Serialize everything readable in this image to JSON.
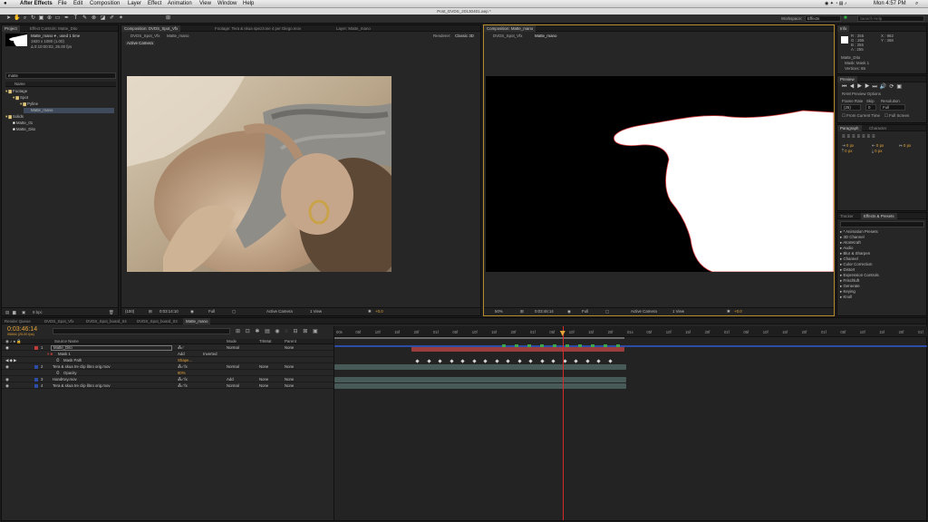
{
  "menubar": {
    "app": "After Effects",
    "items": [
      "File",
      "Edit",
      "Composition",
      "Layer",
      "Effect",
      "Animation",
      "View",
      "Window",
      "Help"
    ],
    "clock": "Mon 4:57 PM"
  },
  "titlebar": "Post_DVDS_20130401.aep *",
  "toolbar": {
    "workspace_label": "Workspace:",
    "workspace_value": "Effects",
    "search_placeholder": "Search Help"
  },
  "project": {
    "tabs": [
      "Project",
      "Effect Controls: Matte_Dito"
    ],
    "item_name": "Matte_mano ▾ , used 1 time",
    "item_dims": "1920 x 1080 (1.00)",
    "item_duration": "Δ 0:10:00:02, 25.00 fps",
    "search_value": "matte",
    "col_name": "Name",
    "tree": [
      "Footage",
      "Spot",
      "Pyline",
      "Matte_mano",
      "Solids",
      "Matte_01",
      "Matte_Dito"
    ],
    "bpc": "8 bpc"
  },
  "comp_left": {
    "tabs": [
      "Composition: DVDS_Spot_Vfx",
      "Footage: Tera & skua spezzone 4 per Diego.mov",
      "Layer: Matte_mano"
    ],
    "subtabs": [
      "DVDS_Spot_Vfx",
      "Matte_mano"
    ],
    "renderer": "Renderer:",
    "renderer_value": "Classic 3D",
    "active_camera": "Active Camera",
    "zoom": "(100)",
    "timecode": "0:03:14:10",
    "resolution": "Full",
    "camera": "Active Camera",
    "views": "1 View",
    "exposure": "+0.0"
  },
  "comp_right": {
    "tabs": [
      "Composition: Matte_mano"
    ],
    "subtabs": [
      "DVDS_Spot_Vfx",
      "Matte_mano"
    ],
    "zoom": "50%",
    "timecode": "0:03:46:14",
    "resolution": "Full",
    "camera": "Active Camera",
    "views": "1 View",
    "exposure": "+0.0"
  },
  "info": {
    "tab": "Info",
    "r": "R : 255",
    "g": "G : 255",
    "b": "B : 255",
    "a": "A : 255",
    "x": "X : 982",
    "y": "Y : 368",
    "layer": "Matte_Dito",
    "mask": "Mask: Mask 1",
    "vertices": "Vertices: 65"
  },
  "preview": {
    "tab": "Preview",
    "ram_options": "RAM Preview Options",
    "frame_rate": "Frame Rate",
    "skip": "Skip",
    "resolution": "Resolution",
    "fps": "(25)",
    "skip_val": "0",
    "res_val": "Full",
    "from_current": "From Current Time",
    "full_screen": "Full Screen"
  },
  "paragraph": {
    "tabs": [
      "Paragraph",
      "Character"
    ],
    "values": [
      "0 px",
      "0 px",
      "0 px",
      "0 px",
      "0 px"
    ]
  },
  "effects": {
    "tabs": [
      "Tracker",
      "Effects & Presets"
    ],
    "items": [
      "* Animation Presets",
      "3D Channel",
      "AtomKraft",
      "Audio",
      "Blur & Sharpen",
      "Channel",
      "Color Correction",
      "Distort",
      "Expression Controls",
      "Frischluft",
      "Generate",
      "Keying",
      "Knoll"
    ]
  },
  "timeline": {
    "tabs": [
      "Render Queue",
      "DVDS_Spot_Vfx",
      "DVDS_Spot_board_04",
      "DVDS_Spot_board_03",
      "Matte_mano"
    ],
    "timecode": "0:03:46:14",
    "frame": "05664 (25.00 fps)",
    "col_source": "Source Name",
    "col_mode": "Mode",
    "col_trkmat": "TrkMat",
    "col_parent": "Parent",
    "layers": [
      {
        "num": "1",
        "name": "Matte_Dito",
        "mode": "Normal",
        "trkmat": "",
        "parent": "None"
      },
      {
        "num": "",
        "name": "Mask 1",
        "mode": "Add",
        "trkmat": "",
        "parent": "Inverted"
      },
      {
        "num": "",
        "name": "Mask Path",
        "mode": "Shape...",
        "trkmat": "",
        "parent": ""
      },
      {
        "num": "2",
        "name": "Tera & skua tre clip libro orig.mov",
        "mode": "Normal",
        "trkmat": "None",
        "parent": "None"
      },
      {
        "num": "",
        "name": "Opacity",
        "mode": "80%",
        "trkmat": "",
        "parent": ""
      },
      {
        "num": "3",
        "name": "HandKey.mov",
        "mode": "Add",
        "trkmat": "None",
        "parent": "None"
      },
      {
        "num": "4",
        "name": "Tera & skua tre clip libro orig.mov",
        "mode": "Normal",
        "trkmat": "None",
        "parent": "None"
      }
    ],
    "ruler": [
      "00s",
      "05f",
      "10f",
      "15f",
      "20f",
      "01f",
      "05f",
      "10f",
      "15f",
      "20f",
      "01f",
      "05f",
      "10f",
      "15f",
      "20f",
      "01s",
      "05f",
      "10f",
      "15f",
      "20f",
      "01f",
      "05f",
      "10f",
      "15f",
      "20f",
      "01f",
      "05f",
      "10f",
      "15f",
      "20f",
      "01f"
    ],
    "playhead_fraction": 0.385,
    "work_start": 0.13,
    "work_end": 0.49
  },
  "colors": {
    "accent": "#e3a338",
    "label_red": "#c23b3b",
    "label_blue": "#2d4ca6",
    "track_green": "#3ca84a",
    "playhead": "#d42a2a"
  }
}
